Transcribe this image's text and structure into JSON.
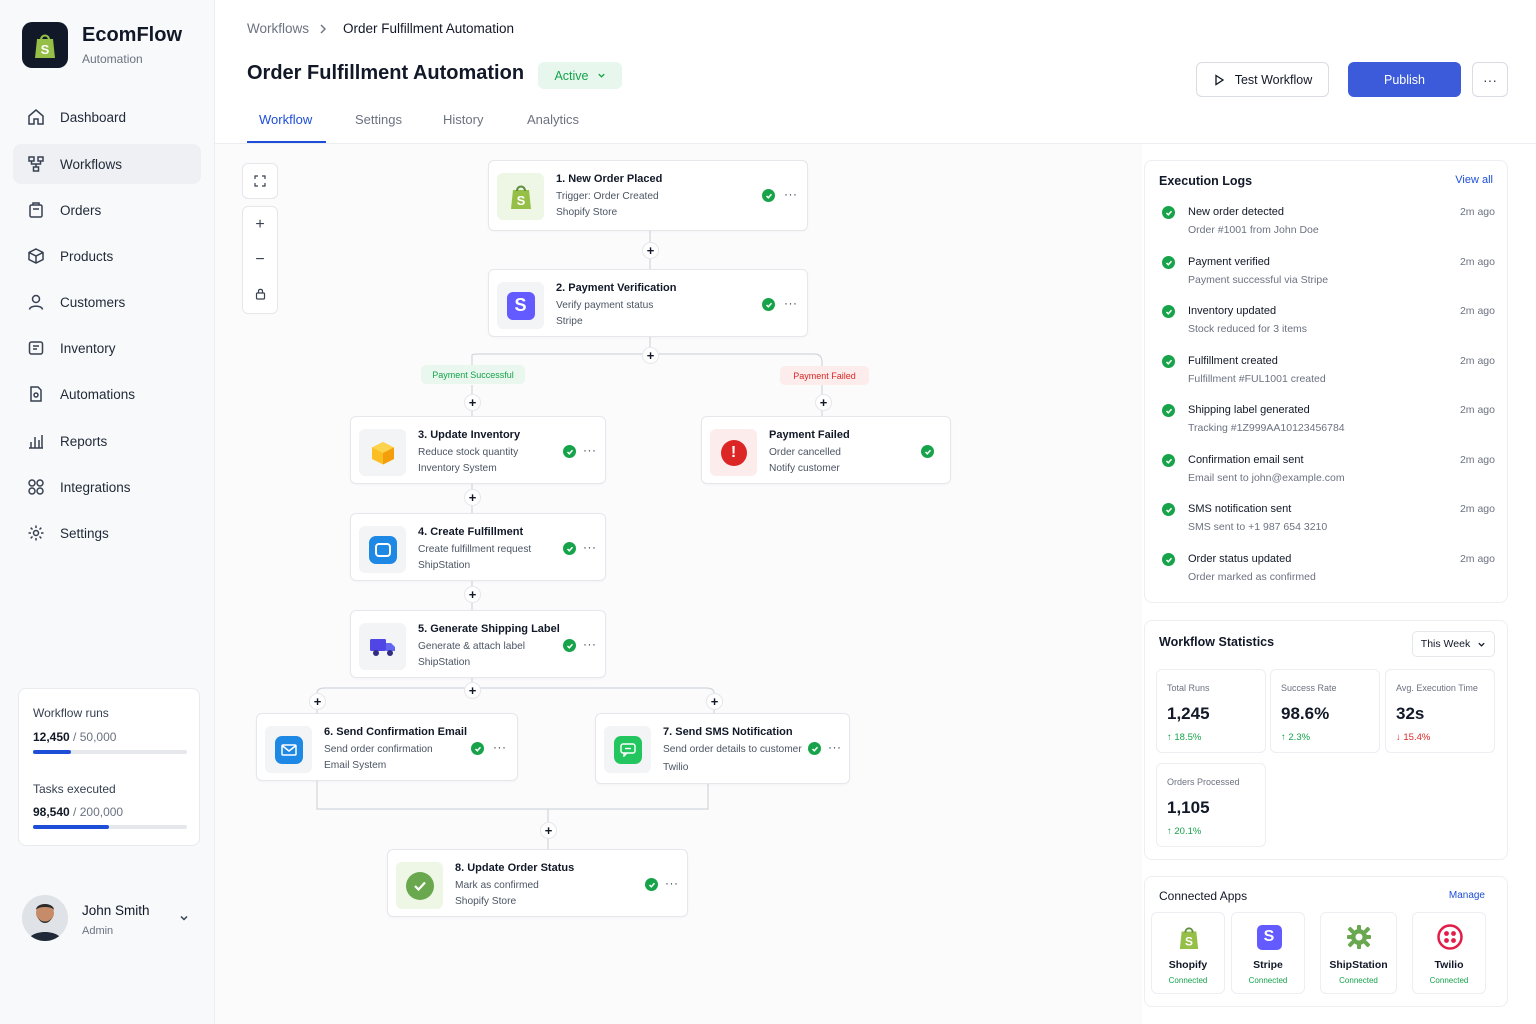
{
  "app": {
    "name": "EcomFlow",
    "subtitle": "Automation"
  },
  "nav": [
    {
      "label": "Dashboard",
      "icon": "home-icon"
    },
    {
      "label": "Workflows",
      "icon": "workflow-icon",
      "active": true
    },
    {
      "label": "Orders",
      "icon": "orders-icon"
    },
    {
      "label": "Products",
      "icon": "products-icon"
    },
    {
      "label": "Customers",
      "icon": "user-icon"
    },
    {
      "label": "Inventory",
      "icon": "inventory-icon"
    },
    {
      "label": "Automations",
      "icon": "automation-icon"
    },
    {
      "label": "Reports",
      "icon": "reports-icon"
    },
    {
      "label": "Integrations",
      "icon": "grid-icon"
    },
    {
      "label": "Settings",
      "icon": "gear-icon"
    }
  ],
  "usage": {
    "runs_label": "Workflow runs",
    "runs_value": "12,450",
    "runs_total": "/ 50,000",
    "runs_fraction": 0.249,
    "tasks_label": "Tasks executed",
    "tasks_value": "98,540",
    "tasks_total": "/ 200,000",
    "tasks_fraction": 0.4927
  },
  "user": {
    "name": "John Smith",
    "role": "Admin"
  },
  "breadcrumb": {
    "parent": "Workflows",
    "current": "Order Fulfillment Automation"
  },
  "header": {
    "title": "Order Fulfillment Automation",
    "status": "Active",
    "test_label": "Test Workflow",
    "publish_label": "Publish"
  },
  "tabs": [
    "Workflow",
    "Settings",
    "History",
    "Analytics"
  ],
  "nodes": {
    "n1": {
      "title": "1.  New Order Placed",
      "line1": "Trigger: Order Created",
      "line2": "Shopify Store"
    },
    "n2": {
      "title": "2.  Payment Verification",
      "line1": "Verify payment status",
      "line2": "Stripe"
    },
    "n3": {
      "title": "3.  Update Inventory",
      "line1": "Reduce stock quantity",
      "line2": "Inventory System"
    },
    "nf": {
      "title": "Payment Failed",
      "line1": "Order cancelled",
      "line2": "Notify customer"
    },
    "n4": {
      "title": "4.  Create Fulfillment",
      "line1": "Create fulfillment request",
      "line2": "ShipStation"
    },
    "n5": {
      "title": "5.  Generate Shipping Label",
      "line1": "Generate & attach label",
      "line2": "ShipStation"
    },
    "n6": {
      "title": "6.  Send Confirmation Email",
      "line1": "Send order confirmation",
      "line2": "Email System"
    },
    "n7": {
      "title": "7.  Send SMS Notification",
      "line1": "Send order details to customer",
      "line2": "Twilio"
    },
    "n8": {
      "title": "8.  Update Order Status",
      "line1": "Mark as confirmed",
      "line2": "Shopify Store"
    }
  },
  "branches": {
    "success": "Payment Successful",
    "failed": "Payment Failed"
  },
  "logs": {
    "title": "Execution Logs",
    "view_all": "View all",
    "items": [
      {
        "title": "New order detected",
        "sub": "Order #1001 from John Doe",
        "time": "2m ago"
      },
      {
        "title": "Payment verified",
        "sub": "Payment successful via Stripe",
        "time": "2m ago"
      },
      {
        "title": "Inventory updated",
        "sub": "Stock reduced for 3 items",
        "time": "2m ago"
      },
      {
        "title": "Fulfillment created",
        "sub": "Fulfillment #FUL1001 created",
        "time": "2m ago"
      },
      {
        "title": "Shipping label generated",
        "sub": "Tracking #1Z999AA10123456784",
        "time": "2m ago"
      },
      {
        "title": "Confirmation email sent",
        "sub": "Email sent to john@example.com",
        "time": "2m ago"
      },
      {
        "title": "SMS notification sent",
        "sub": "SMS sent to +1 987 654 3210",
        "time": "2m ago"
      },
      {
        "title": "Order status updated",
        "sub": "Order marked as confirmed",
        "time": "2m ago"
      }
    ]
  },
  "stats": {
    "title": "Workflow Statistics",
    "period": "This Week",
    "items": [
      {
        "label": "Total Runs",
        "value": "1,245",
        "change": "18.5%",
        "direction": "up"
      },
      {
        "label": "Success Rate",
        "value": "98.6%",
        "change": "2.3%",
        "direction": "up"
      },
      {
        "label": "Avg. Execution Time",
        "value": "32s",
        "change": "15.4%",
        "direction": "down"
      },
      {
        "label": "Orders Processed",
        "value": "1,105",
        "change": "20.1%",
        "direction": "up"
      }
    ]
  },
  "apps": {
    "title": "Connected Apps",
    "manage": "Manage",
    "items": [
      {
        "name": "Shopify",
        "status": "Connected"
      },
      {
        "name": "Stripe",
        "status": "Connected"
      },
      {
        "name": "ShipStation",
        "status": "Connected"
      },
      {
        "name": "Twilio",
        "status": "Connected"
      }
    ]
  },
  "colors": {
    "accent": "#3b5bdb",
    "success": "#16a34a",
    "danger": "#dc2626"
  }
}
